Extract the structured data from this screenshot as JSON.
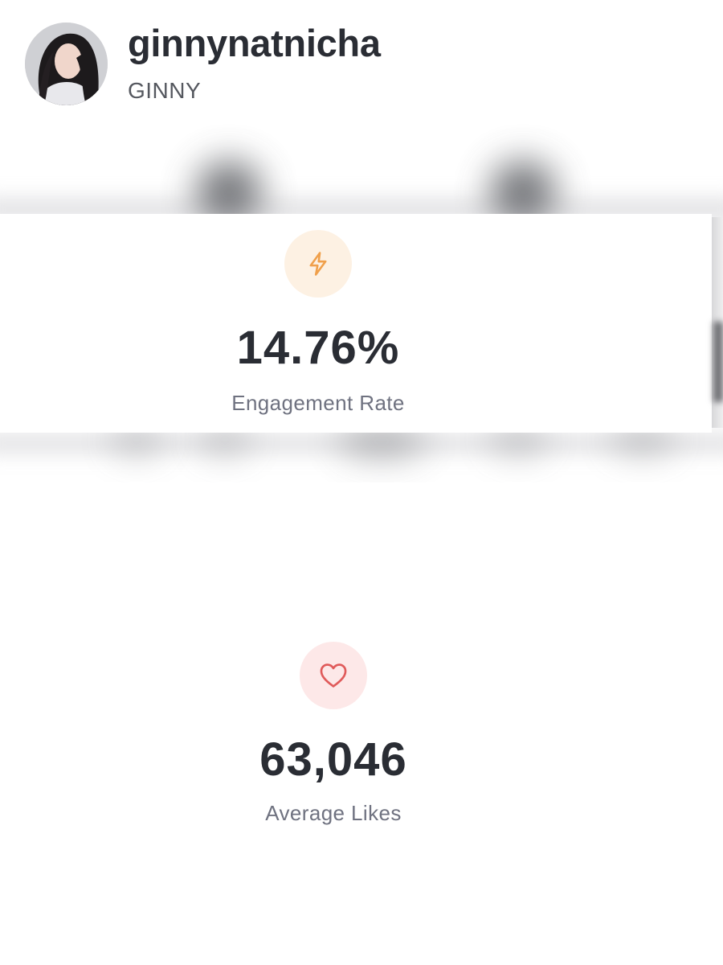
{
  "profile": {
    "username": "ginnynatnicha",
    "display_name": "GINNY",
    "avatar_icon": "profile-photo"
  },
  "stats": [
    {
      "icon": "lightning-icon",
      "value": "14.76%",
      "label": "Engagement Rate",
      "accent": "#f0a04b",
      "icon_bg": "#fdf1e3"
    },
    {
      "icon": "heart-icon",
      "value": "63,046",
      "label": "Average Likes",
      "accent": "#e05a5a",
      "icon_bg": "#fde8e8"
    }
  ]
}
